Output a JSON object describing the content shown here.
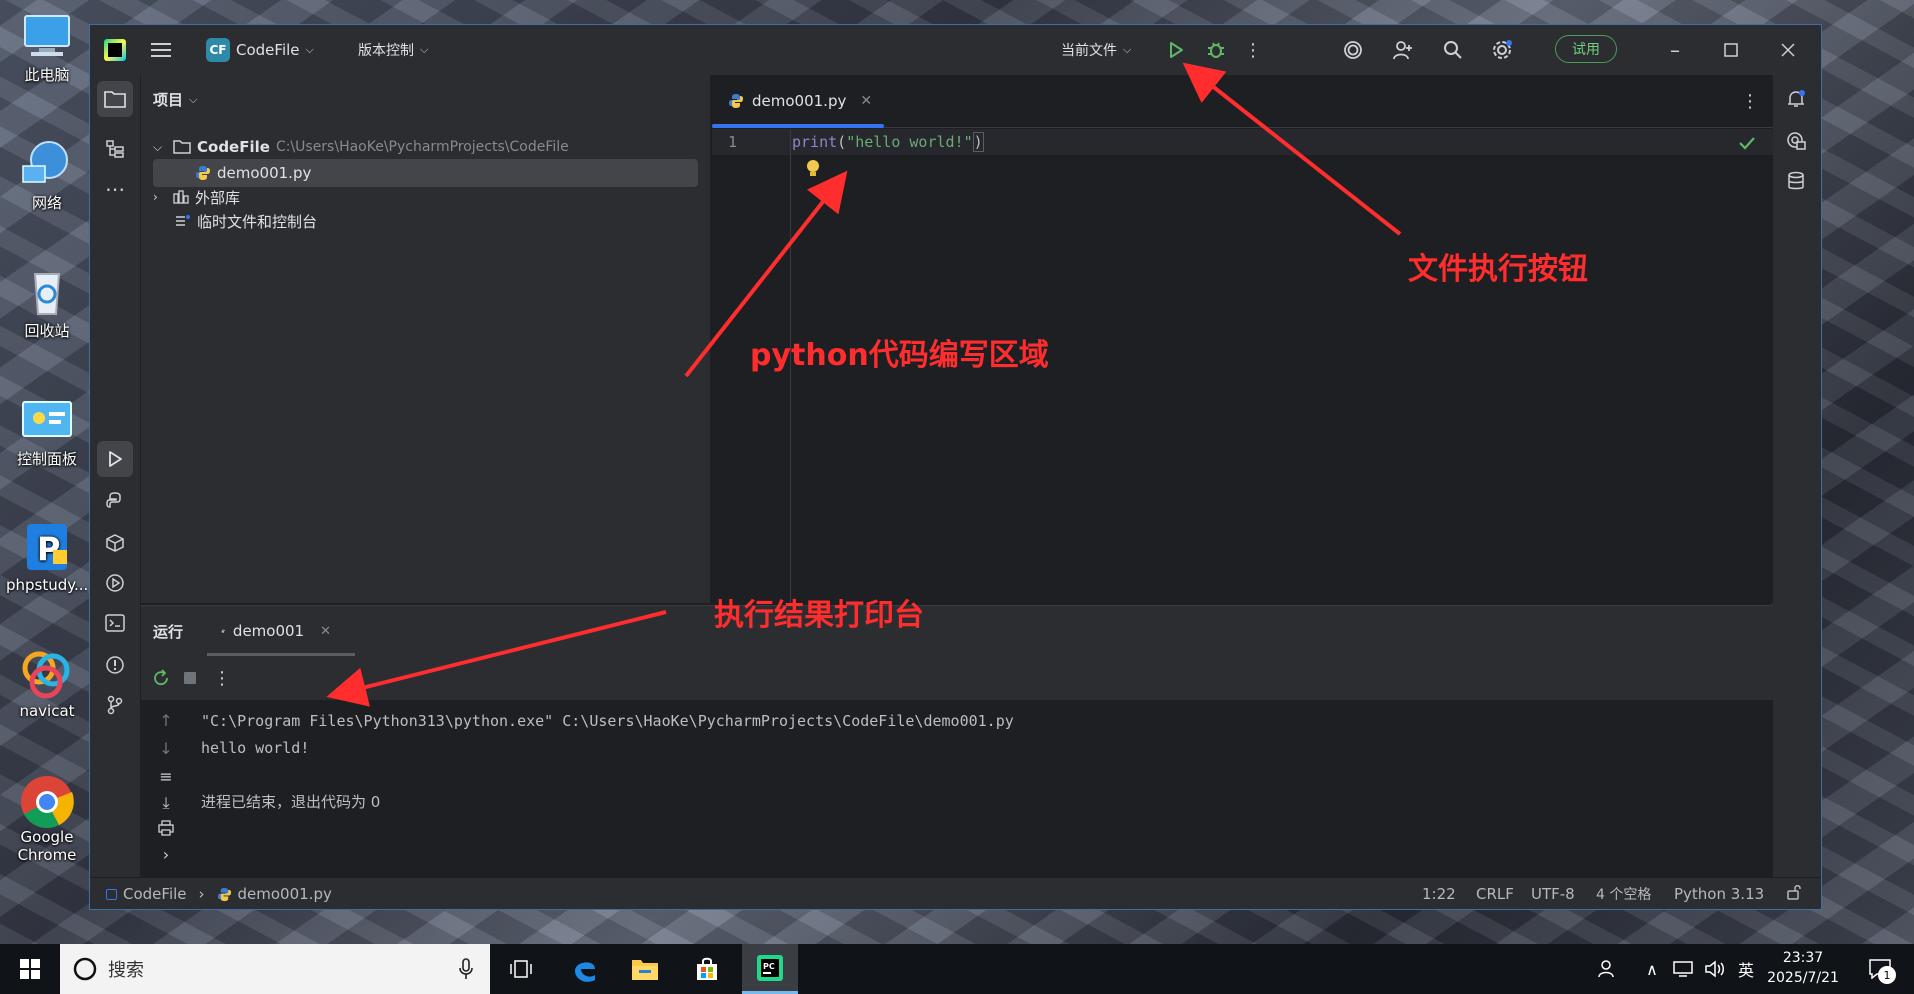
{
  "desktop": {
    "icons": [
      {
        "label": "此电脑",
        "icon": "computer-icon"
      },
      {
        "label": "网络",
        "icon": "network-icon"
      },
      {
        "label": "回收站",
        "icon": "recycle-bin-icon"
      },
      {
        "label": "控制面板",
        "icon": "control-panel-icon"
      },
      {
        "label": "phpstudy...",
        "icon": "phpstudy-icon"
      },
      {
        "label": "navicat",
        "icon": "navicat-icon"
      },
      {
        "label": "Google",
        "label2": "Chrome",
        "icon": "chrome-icon"
      }
    ]
  },
  "titlebar": {
    "project_badge": "CF",
    "project_name": "CodeFile",
    "vcs": "版本控制",
    "run_config": "当前文件",
    "trial": "试用"
  },
  "project_panel": {
    "title": "项目",
    "root_name": "CodeFile",
    "root_path": "C:\\Users\\HaoKe\\PycharmProjects\\CodeFile",
    "file": "demo001.py",
    "external_libs": "外部库",
    "scratches": "临时文件和控制台"
  },
  "editor": {
    "tab_name": "demo001.py",
    "line_number": "1",
    "code_func": "print",
    "code_open": "(",
    "code_string": "\"hello world!\"",
    "code_close": ")"
  },
  "run_panel": {
    "title": "运行",
    "tab_name": "demo001",
    "console": {
      "line1": "\"C:\\Program Files\\Python313\\python.exe\" C:\\Users\\HaoKe\\PycharmProjects\\CodeFile\\demo001.py",
      "line2": "hello world!",
      "line3": "进程已结束，退出代码为 0"
    }
  },
  "statusbar": {
    "crumb_project": "CodeFile",
    "crumb_file": "demo001.py",
    "position": "1:22",
    "line_sep": "CRLF",
    "encoding": "UTF-8",
    "indent": "4 个空格",
    "interpreter": "Python 3.13"
  },
  "annotations": {
    "run_button": "文件执行按钮",
    "code_area": "python代码编写区域",
    "console": "执行结果打印台"
  },
  "taskbar": {
    "search_placeholder": "搜索",
    "ime": "英",
    "time": "23:37",
    "date": "2025/7/21",
    "notify_count": "1"
  },
  "colors": {
    "accent": "#3574f0",
    "run_green": "#5fb865",
    "annotation_red": "#ff2d2d",
    "string_green": "#6aab73",
    "func_purple": "#a9b7c6"
  }
}
